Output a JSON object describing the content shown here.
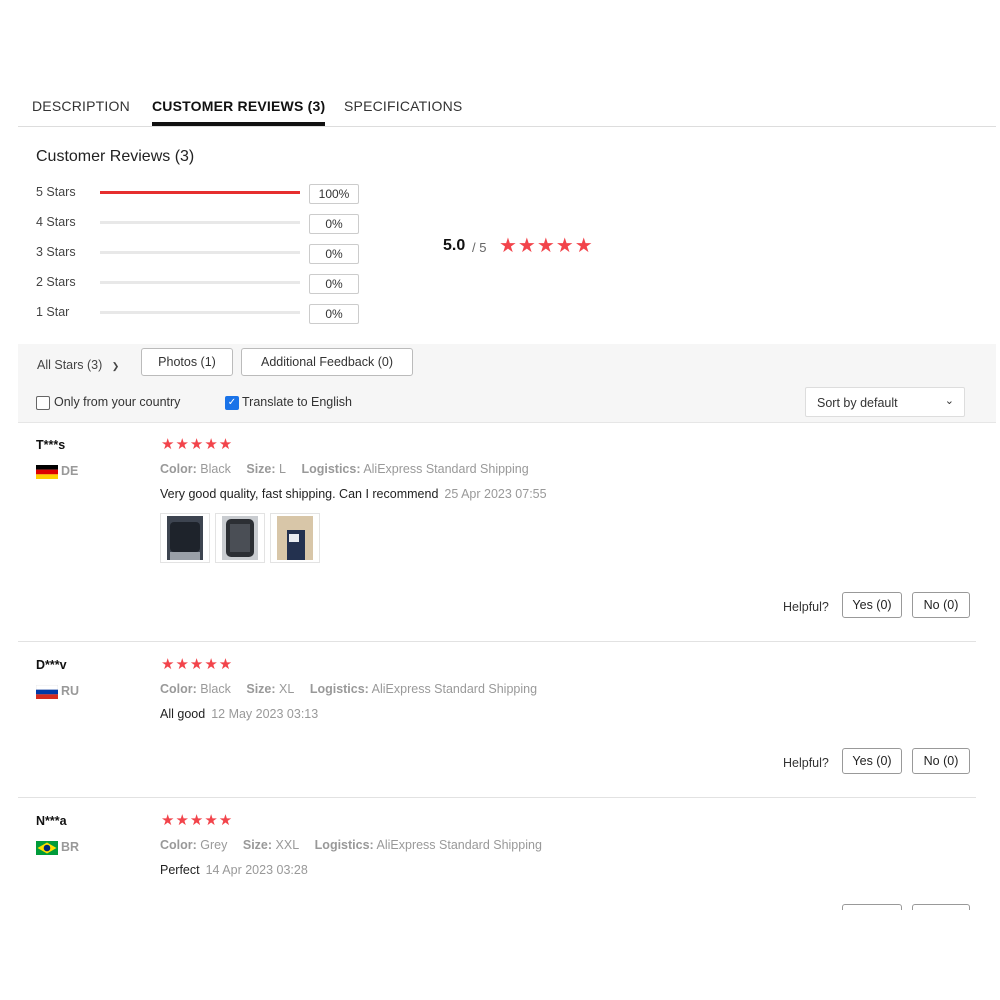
{
  "tabs": [
    "DESCRIPTION",
    "CUSTOMER REVIEWS (3)",
    "SPECIFICATIONS"
  ],
  "summary": {
    "title": "Customer Reviews (3)",
    "distribution": [
      {
        "label": "5 Stars",
        "percent": "100%",
        "fraction": 1.0
      },
      {
        "label": "4 Stars",
        "percent": "0%",
        "fraction": 0
      },
      {
        "label": "3 Stars",
        "percent": "0%",
        "fraction": 0
      },
      {
        "label": "2 Stars",
        "percent": "0%",
        "fraction": 0
      },
      {
        "label": "1 Star",
        "percent": "0%",
        "fraction": 0
      }
    ],
    "average": "5.0",
    "average_of": "/ 5",
    "stars": "★★★★★",
    "star_color": "#f2444b"
  },
  "filters": {
    "all_stars": "All Stars (3)",
    "photos": "Photos (1)",
    "additional_feedback": "Additional Feedback (0)",
    "only_country": "Only from your country",
    "only_country_checked": false,
    "translate": "Translate to English",
    "translate_checked": true,
    "sort": "Sort by default"
  },
  "reviews": [
    {
      "name": "T***s",
      "country": "DE",
      "flag": "germany-flag",
      "stars": "★★★★★",
      "color_label": "Color:",
      "color": "Black",
      "size_label": "Size:",
      "size": "L",
      "logistics_label": "Logistics:",
      "logistics": "AliExpress Standard Shipping",
      "text": "Very good quality, fast shipping. Can I recommend",
      "date": "25 Apr 2023 07:55",
      "photos": 3,
      "helpful": "Helpful?",
      "yes": "Yes (0)",
      "no": "No (0)"
    },
    {
      "name": "D***v",
      "country": "RU",
      "flag": "russia-flag",
      "stars": "★★★★★",
      "color_label": "Color:",
      "color": "Black",
      "size_label": "Size:",
      "size": "XL",
      "logistics_label": "Logistics:",
      "logistics": "AliExpress Standard Shipping",
      "text": "All good",
      "date": "12 May 2023 03:13",
      "photos": 0,
      "helpful": "Helpful?",
      "yes": "Yes (0)",
      "no": "No (0)"
    },
    {
      "name": "N***a",
      "country": "BR",
      "flag": "brazil-flag",
      "stars": "★★★★★",
      "color_label": "Color:",
      "color": "Grey",
      "size_label": "Size:",
      "size": "XXL",
      "logistics_label": "Logistics:",
      "logistics": "AliExpress Standard Shipping",
      "text": "Perfect",
      "date": "14 Apr 2023 03:28",
      "photos": 0
    }
  ]
}
